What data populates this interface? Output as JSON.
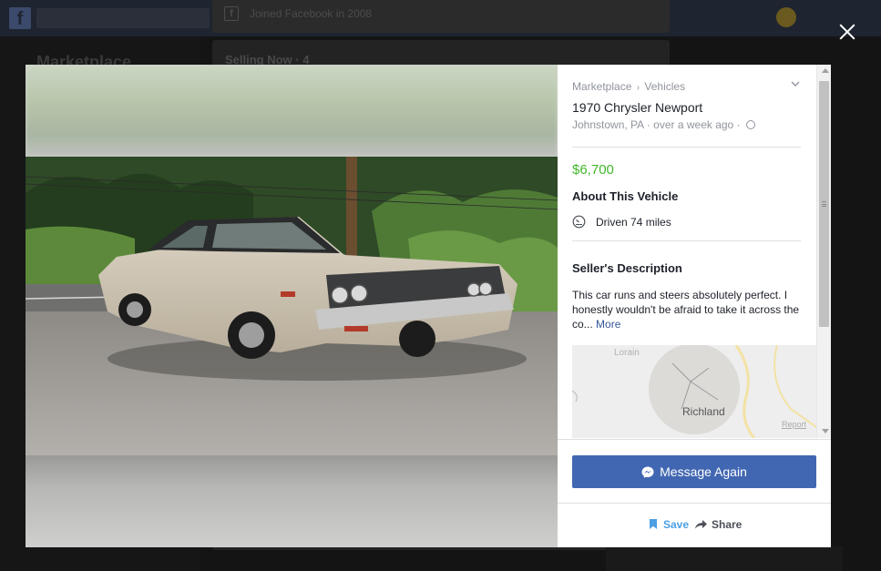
{
  "background": {
    "joined_text": "Joined Facebook in 2008",
    "selling_text": "Selling Now · 4",
    "sidebar_title": "Marketplace"
  },
  "breadcrumb": {
    "root": "Marketplace",
    "separator": "›",
    "category": "Vehicles"
  },
  "listing": {
    "title": "1970 Chrysler Newport",
    "location": "Johnstown, PA",
    "time": "over a week ago",
    "price": "$6,700",
    "about_heading": "About This Vehicle",
    "driven": "Driven 74 miles",
    "seller_heading": "Seller's Description",
    "description": "This car runs and steers absolutely perfect. I honestly wouldn't be afraid to take it across the co...",
    "more_label": "More"
  },
  "map": {
    "town_top": "Lorain",
    "town_center": "Richland",
    "report_label": "Report"
  },
  "actions": {
    "message_label": "Message Again",
    "save_label": "Save",
    "share_label": "Share"
  },
  "colors": {
    "price": "#42b72a",
    "button_primary": "#4267b2",
    "save": "#4b9fe2",
    "link": "#365899"
  }
}
